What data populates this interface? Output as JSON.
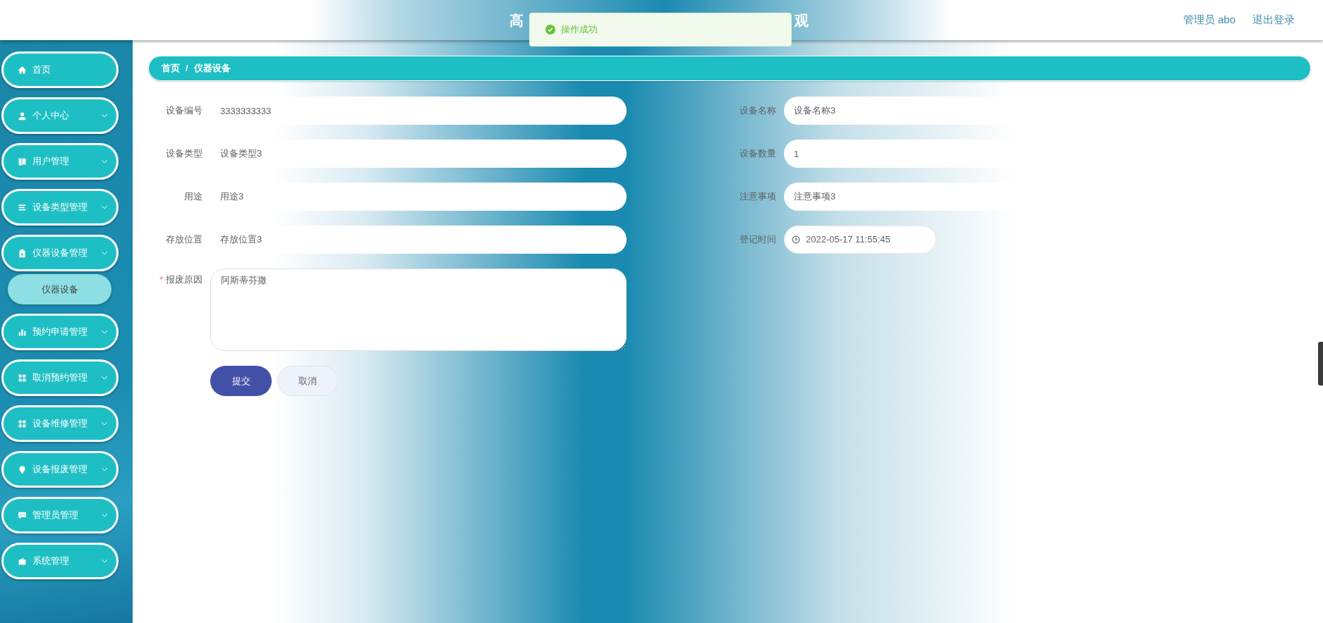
{
  "header": {
    "title_parts": [
      "高",
      "观"
    ],
    "user": "管理员 abo",
    "logout": "退出登录"
  },
  "toast": {
    "kind": "success",
    "message": "操作成功"
  },
  "sidebar": {
    "items": [
      {
        "label": "首页",
        "expandable": false
      },
      {
        "label": "个人中心",
        "expandable": true
      },
      {
        "label": "用户管理",
        "expandable": true
      },
      {
        "label": "设备类型管理",
        "expandable": true
      },
      {
        "label": "仪器设备管理",
        "expandable": true,
        "children": [
          {
            "label": "仪器设备",
            "selected": true
          }
        ]
      },
      {
        "label": "预约申请管理",
        "expandable": true
      },
      {
        "label": "取消预约管理",
        "expandable": true
      },
      {
        "label": "设备维修管理",
        "expandable": true
      },
      {
        "label": "设备报废管理",
        "expandable": true
      },
      {
        "label": "管理员管理",
        "expandable": true
      },
      {
        "label": "系统管理",
        "expandable": true
      }
    ]
  },
  "breadcrumb": {
    "items": [
      "首页",
      "仪器设备"
    ],
    "separator": "/"
  },
  "form": {
    "left_fields": [
      {
        "label": "设备编号",
        "value": "3333333333",
        "kind": "text"
      },
      {
        "label": "设备类型",
        "value": "设备类型3",
        "kind": "text"
      },
      {
        "label": "用途",
        "value": "用途3",
        "kind": "text"
      },
      {
        "label": "存放位置",
        "value": "存放位置3",
        "kind": "text"
      },
      {
        "label": "报废原因",
        "value": "阿斯蒂芬撒",
        "kind": "textarea",
        "required_mark": "*"
      }
    ],
    "right_fields": [
      {
        "label": "设备名称",
        "value": "设备名称3",
        "kind": "text"
      },
      {
        "label": "设备数量",
        "value": "1",
        "kind": "text"
      },
      {
        "label": "注意事项",
        "value": "注意事项3",
        "kind": "text"
      },
      {
        "label": "登记时间",
        "value": "2022-05-17 11:55:45",
        "kind": "date"
      }
    ],
    "buttons": [
      {
        "label": "提交",
        "kind": "primary"
      },
      {
        "label": "取消",
        "kind": "secondary"
      }
    ]
  }
}
